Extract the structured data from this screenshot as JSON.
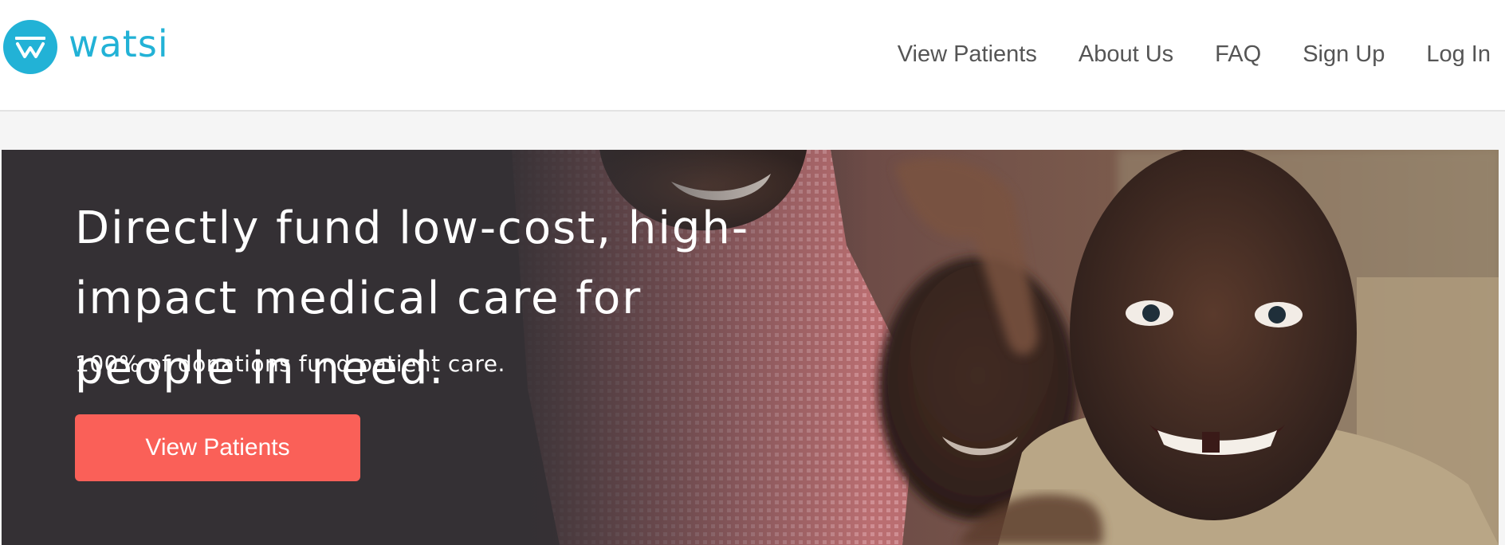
{
  "brand": {
    "name": "watsi",
    "color": "#22b2d6",
    "logo_icon": "watsi-w-icon"
  },
  "nav": {
    "items": [
      {
        "label": "View Patients"
      },
      {
        "label": "About Us"
      },
      {
        "label": "FAQ"
      },
      {
        "label": "Sign Up"
      },
      {
        "label": "Log In"
      }
    ]
  },
  "hero": {
    "title": "Directly fund low-cost, high-impact medical care for people in need.",
    "subtitle": "100% of donations fund patient care.",
    "cta_label": "View Patients",
    "cta_color": "#fa6058",
    "image": "smiling-children-photo"
  }
}
